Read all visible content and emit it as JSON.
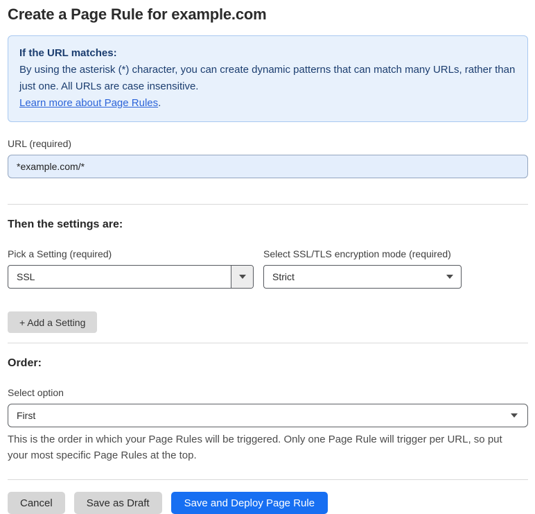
{
  "page": {
    "title": "Create a Page Rule for example.com"
  },
  "info_box": {
    "heading": "If the URL matches:",
    "body": "By using the asterisk (*) character, you can create dynamic patterns that can match many URLs, rather than just one. All URLs are case insensitive.",
    "link_label": "Learn more about Page Rules",
    "link_suffix": "."
  },
  "url_field": {
    "label": "URL (required)",
    "value": "*example.com/*"
  },
  "settings": {
    "heading": "Then the settings are:",
    "setting_select": {
      "label": "Pick a Setting (required)",
      "value": "SSL"
    },
    "mode_select": {
      "label": "Select SSL/TLS encryption mode (required)",
      "value": "Strict"
    },
    "add_button_label": "+ Add a Setting"
  },
  "order": {
    "heading": "Order:",
    "select_label": "Select option",
    "value": "First",
    "help_text": "This is the order in which your Page Rules will be triggered. Only one Page Rule will trigger per URL, so put your most specific Page Rules at the top."
  },
  "footer": {
    "cancel_label": "Cancel",
    "save_draft_label": "Save as Draft",
    "save_deploy_label": "Save and Deploy Page Rule"
  },
  "colors": {
    "accent_blue": "#176ff2",
    "info_background": "#e8f1fc",
    "info_border": "#a9c9f0",
    "info_text": "#1b3d6f",
    "link_blue": "#2c64d9",
    "input_background": "#e4eefc"
  }
}
